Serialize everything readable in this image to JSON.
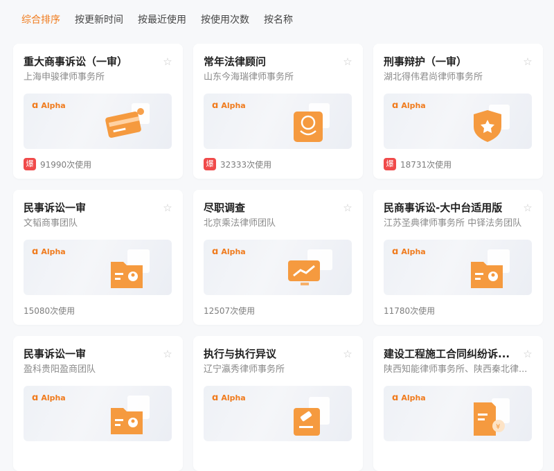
{
  "tabs": [
    {
      "label": "综合排序",
      "active": true
    },
    {
      "label": "按更新时间",
      "active": false
    },
    {
      "label": "按最近使用",
      "active": false
    },
    {
      "label": "按使用次数",
      "active": false
    },
    {
      "label": "按名称",
      "active": false
    }
  ],
  "colors": {
    "accent": "#f07b1d",
    "hot_badge": "#f04a4a"
  },
  "badge_brand": "Alpha",
  "hot_label": "爆",
  "cards": [
    {
      "title": "重大商事诉讼（一审）",
      "subtitle": "上海申骏律师事务所",
      "usage": "91990次使用",
      "hot": true,
      "icon": "card-icon"
    },
    {
      "title": "常年法律顾问",
      "subtitle": "山东今海瑞律师事务所",
      "usage": "32333次使用",
      "hot": true,
      "icon": "handshake-icon"
    },
    {
      "title": "刑事辩护（一审）",
      "subtitle": "湖北得伟君尚律师事务所",
      "usage": "18731次使用",
      "hot": true,
      "icon": "shield-star-icon"
    },
    {
      "title": "民事诉讼一审",
      "subtitle": "文韬商事团队",
      "usage": "15080次使用",
      "hot": false,
      "icon": "folder-user-icon"
    },
    {
      "title": "尽职调查",
      "subtitle": "北京乘法律师团队",
      "usage": "12507次使用",
      "hot": false,
      "icon": "monitor-chart-icon"
    },
    {
      "title": "民商事诉讼-大中台适用版",
      "subtitle": "江苏圣典律师事务所 中铎法务团队",
      "usage": "11780次使用",
      "hot": false,
      "icon": "folder-user-icon"
    },
    {
      "title": "民事诉讼一审",
      "subtitle": "盈科贵阳盈商团队",
      "usage": "",
      "hot": false,
      "icon": "folder-user-icon"
    },
    {
      "title": "执行与执行异议",
      "subtitle": "辽宁瀛秀律师事务所",
      "usage": "",
      "hot": false,
      "icon": "gavel-icon"
    },
    {
      "title": "建设工程施工合同纠纷诉...",
      "subtitle": "陕西知能律师事务所、陕西秦北律...",
      "usage": "",
      "hot": false,
      "icon": "document-yuan-icon"
    }
  ]
}
